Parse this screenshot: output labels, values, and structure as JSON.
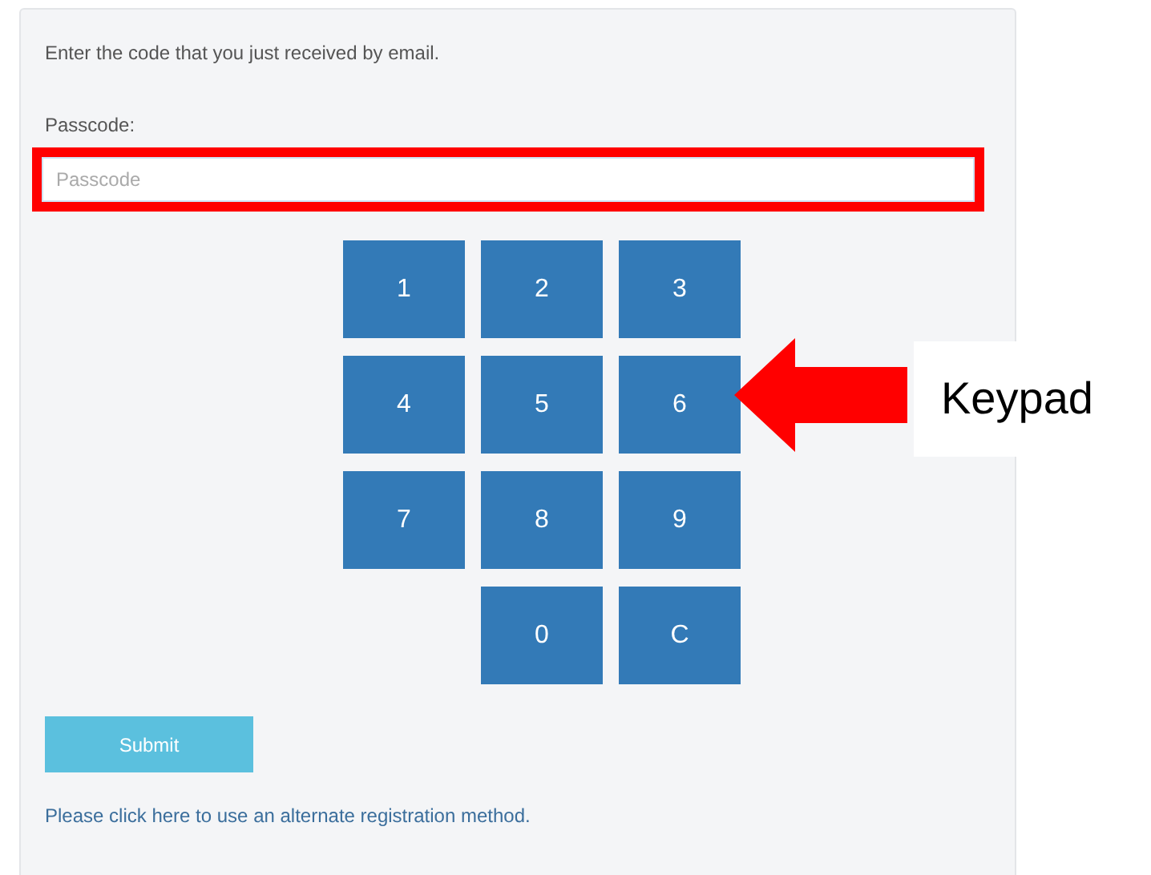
{
  "instruction": "Enter the code that you just received by email.",
  "passcode": {
    "label": "Passcode:",
    "placeholder": "Passcode",
    "highlighted": true
  },
  "keypad": [
    {
      "kind": "key",
      "label": "1"
    },
    {
      "kind": "key",
      "label": "2"
    },
    {
      "kind": "key",
      "label": "3"
    },
    {
      "kind": "key",
      "label": "4"
    },
    {
      "kind": "key",
      "label": "5"
    },
    {
      "kind": "key",
      "label": "6"
    },
    {
      "kind": "key",
      "label": "7"
    },
    {
      "kind": "key",
      "label": "8"
    },
    {
      "kind": "key",
      "label": "9"
    },
    {
      "kind": "spacer"
    },
    {
      "kind": "key",
      "label": "0"
    },
    {
      "kind": "key",
      "label": "C"
    }
  ],
  "submit": {
    "label": "Submit"
  },
  "alternate_link": "Please click here to use an alternate registration method.",
  "annotation": {
    "label": "Keypad"
  }
}
